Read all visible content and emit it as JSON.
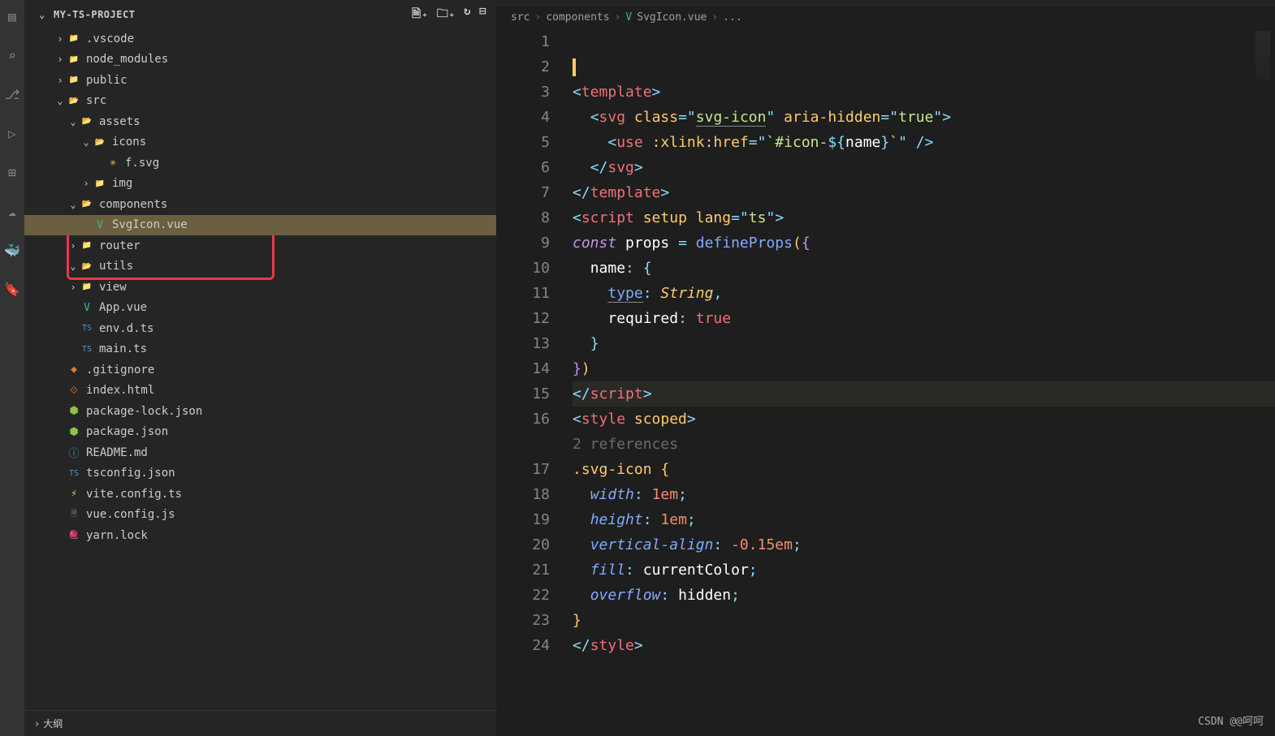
{
  "header": {
    "title": "MY-TS-PROJECT"
  },
  "tree": [
    {
      "indent": 1,
      "tw": "›",
      "c": "fc",
      "ico": "📁",
      "label": ".vscode"
    },
    {
      "indent": 1,
      "tw": "›",
      "c": "fc-g",
      "ico": "📁",
      "label": "node_modules"
    },
    {
      "indent": 1,
      "tw": "›",
      "c": "fc",
      "ico": "📁",
      "label": "public"
    },
    {
      "indent": 1,
      "tw": "⌄",
      "c": "fc-g",
      "ico": "📂",
      "label": "src"
    },
    {
      "indent": 2,
      "tw": "⌄",
      "c": "fc",
      "ico": "📂",
      "label": "assets"
    },
    {
      "indent": 3,
      "tw": "⌄",
      "c": "fc-b",
      "ico": "📂",
      "label": "icons"
    },
    {
      "indent": 4,
      "tw": "",
      "c": "fc-y",
      "ico": "✳",
      "label": "f.svg"
    },
    {
      "indent": 3,
      "tw": "›",
      "c": "fc-b",
      "ico": "📁",
      "label": "img"
    },
    {
      "indent": 2,
      "tw": "⌄",
      "c": "fc-y",
      "ico": "📂",
      "label": "components"
    },
    {
      "indent": 3,
      "tw": "",
      "c": "fc-vue",
      "ico": "V",
      "label": "SvgIcon.vue",
      "sel": true
    },
    {
      "indent": 2,
      "tw": "›",
      "c": "fc-g",
      "ico": "📁",
      "label": "router"
    },
    {
      "indent": 2,
      "tw": "⌄",
      "c": "fc-g",
      "ico": "📂",
      "label": "utils"
    },
    {
      "indent": 2,
      "tw": "›",
      "c": "fc-r",
      "ico": "📁",
      "label": "view"
    },
    {
      "indent": 2,
      "tw": "",
      "c": "fc-vue",
      "ico": "V",
      "label": "App.vue"
    },
    {
      "indent": 2,
      "tw": "",
      "c": "fc-b",
      "ico": "TS",
      "label": "env.d.ts"
    },
    {
      "indent": 2,
      "tw": "",
      "c": "fc-b",
      "ico": "TS",
      "label": "main.ts"
    },
    {
      "indent": 1,
      "tw": "",
      "c": "fc-o",
      "ico": "◆",
      "label": ".gitignore"
    },
    {
      "indent": 1,
      "tw": "",
      "c": "fc-o",
      "ico": "⟐",
      "label": "index.html"
    },
    {
      "indent": 1,
      "tw": "",
      "c": "fc-g",
      "ico": "⬢",
      "label": "package-lock.json"
    },
    {
      "indent": 1,
      "tw": "",
      "c": "fc-g",
      "ico": "⬢",
      "label": "package.json"
    },
    {
      "indent": 1,
      "tw": "",
      "c": "fc-md",
      "ico": "ⓘ",
      "label": "README.md"
    },
    {
      "indent": 1,
      "tw": "",
      "c": "fc-b",
      "ico": "TS",
      "label": "tsconfig.json"
    },
    {
      "indent": 1,
      "tw": "",
      "c": "fc-y",
      "ico": "⚡",
      "label": "vite.config.ts"
    },
    {
      "indent": 1,
      "tw": "",
      "c": "fc-i",
      "ico": "🗎",
      "label": "vue.config.js"
    },
    {
      "indent": 1,
      "tw": "",
      "c": "fc-b",
      "ico": "🧶",
      "label": "yarn.lock"
    }
  ],
  "outline": "大纲",
  "breadcrumbs": [
    "src",
    "components",
    "SvgIcon.vue",
    "..."
  ],
  "code_hint": "2 references",
  "lines": [
    "1",
    "2",
    "3",
    "4",
    "5",
    "6",
    "7",
    "8",
    "9",
    "10",
    "11",
    "12",
    "13",
    "14",
    "15",
    "16",
    "17",
    "18",
    "19",
    "20",
    "21",
    "22",
    "23",
    "24"
  ],
  "watermark": "CSDN @@呵呵"
}
